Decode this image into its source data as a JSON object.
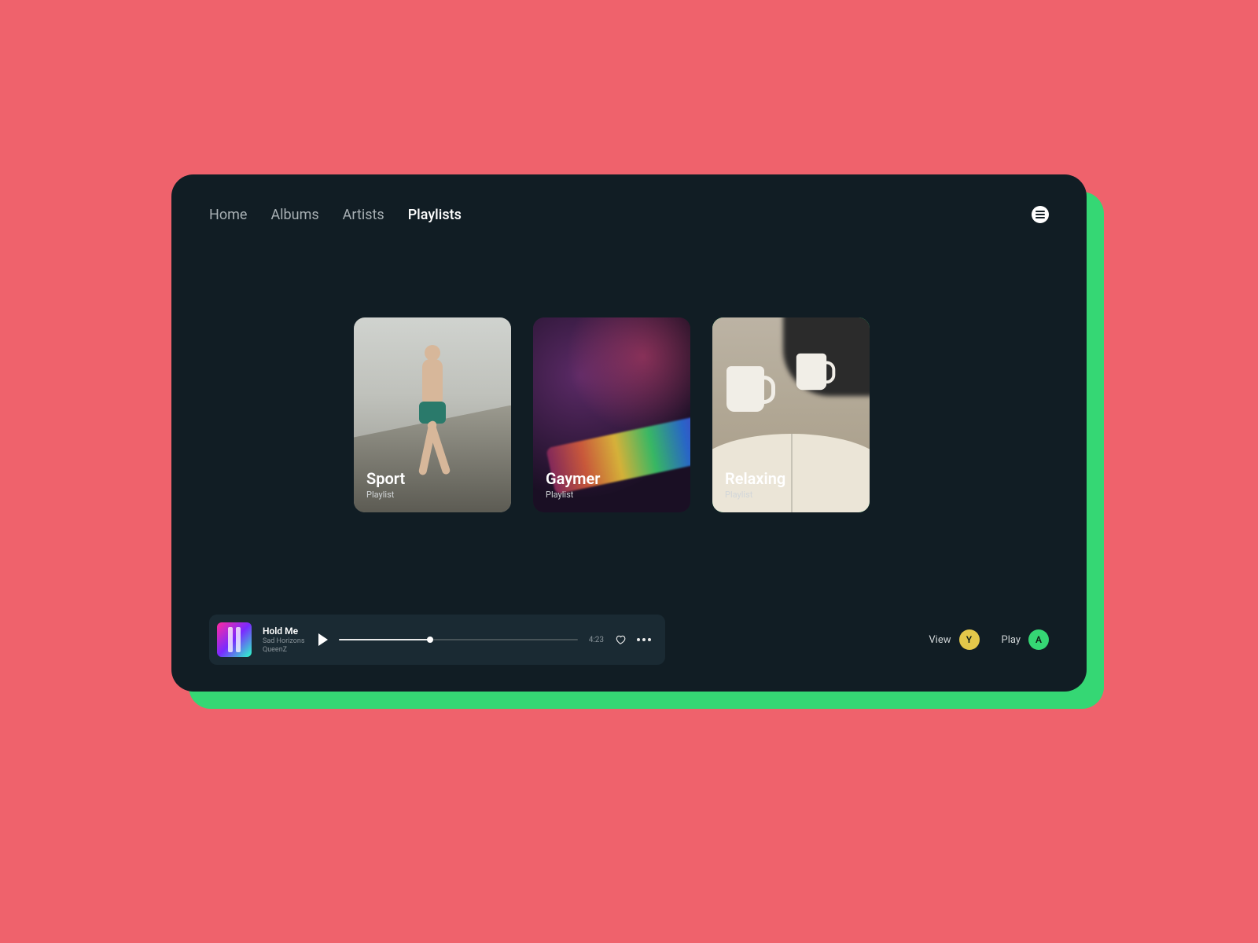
{
  "nav": {
    "items": [
      {
        "label": "Home",
        "active": false
      },
      {
        "label": "Albums",
        "active": false
      },
      {
        "label": "Artists",
        "active": false
      },
      {
        "label": "Playlists",
        "active": true
      }
    ]
  },
  "playlists": {
    "subtitle": "Playlist",
    "items": [
      {
        "title": "Sport",
        "selected": false
      },
      {
        "title": "Gaymer",
        "selected": false
      },
      {
        "title": "Relaxing",
        "selected": true
      }
    ]
  },
  "player": {
    "track_title": "Hold Me",
    "album": "Sad Horizons",
    "artist": "QueenZ",
    "time": "4:23",
    "progress_pct": 38
  },
  "controls": {
    "view": {
      "label": "View",
      "key": "Y"
    },
    "play": {
      "label": "Play",
      "key": "A"
    }
  },
  "colors": {
    "accent": "#35d774",
    "bg_card": "#111d24",
    "bg_stage": "#ef626c",
    "key_y": "#e3c74a",
    "key_a": "#35d774"
  }
}
